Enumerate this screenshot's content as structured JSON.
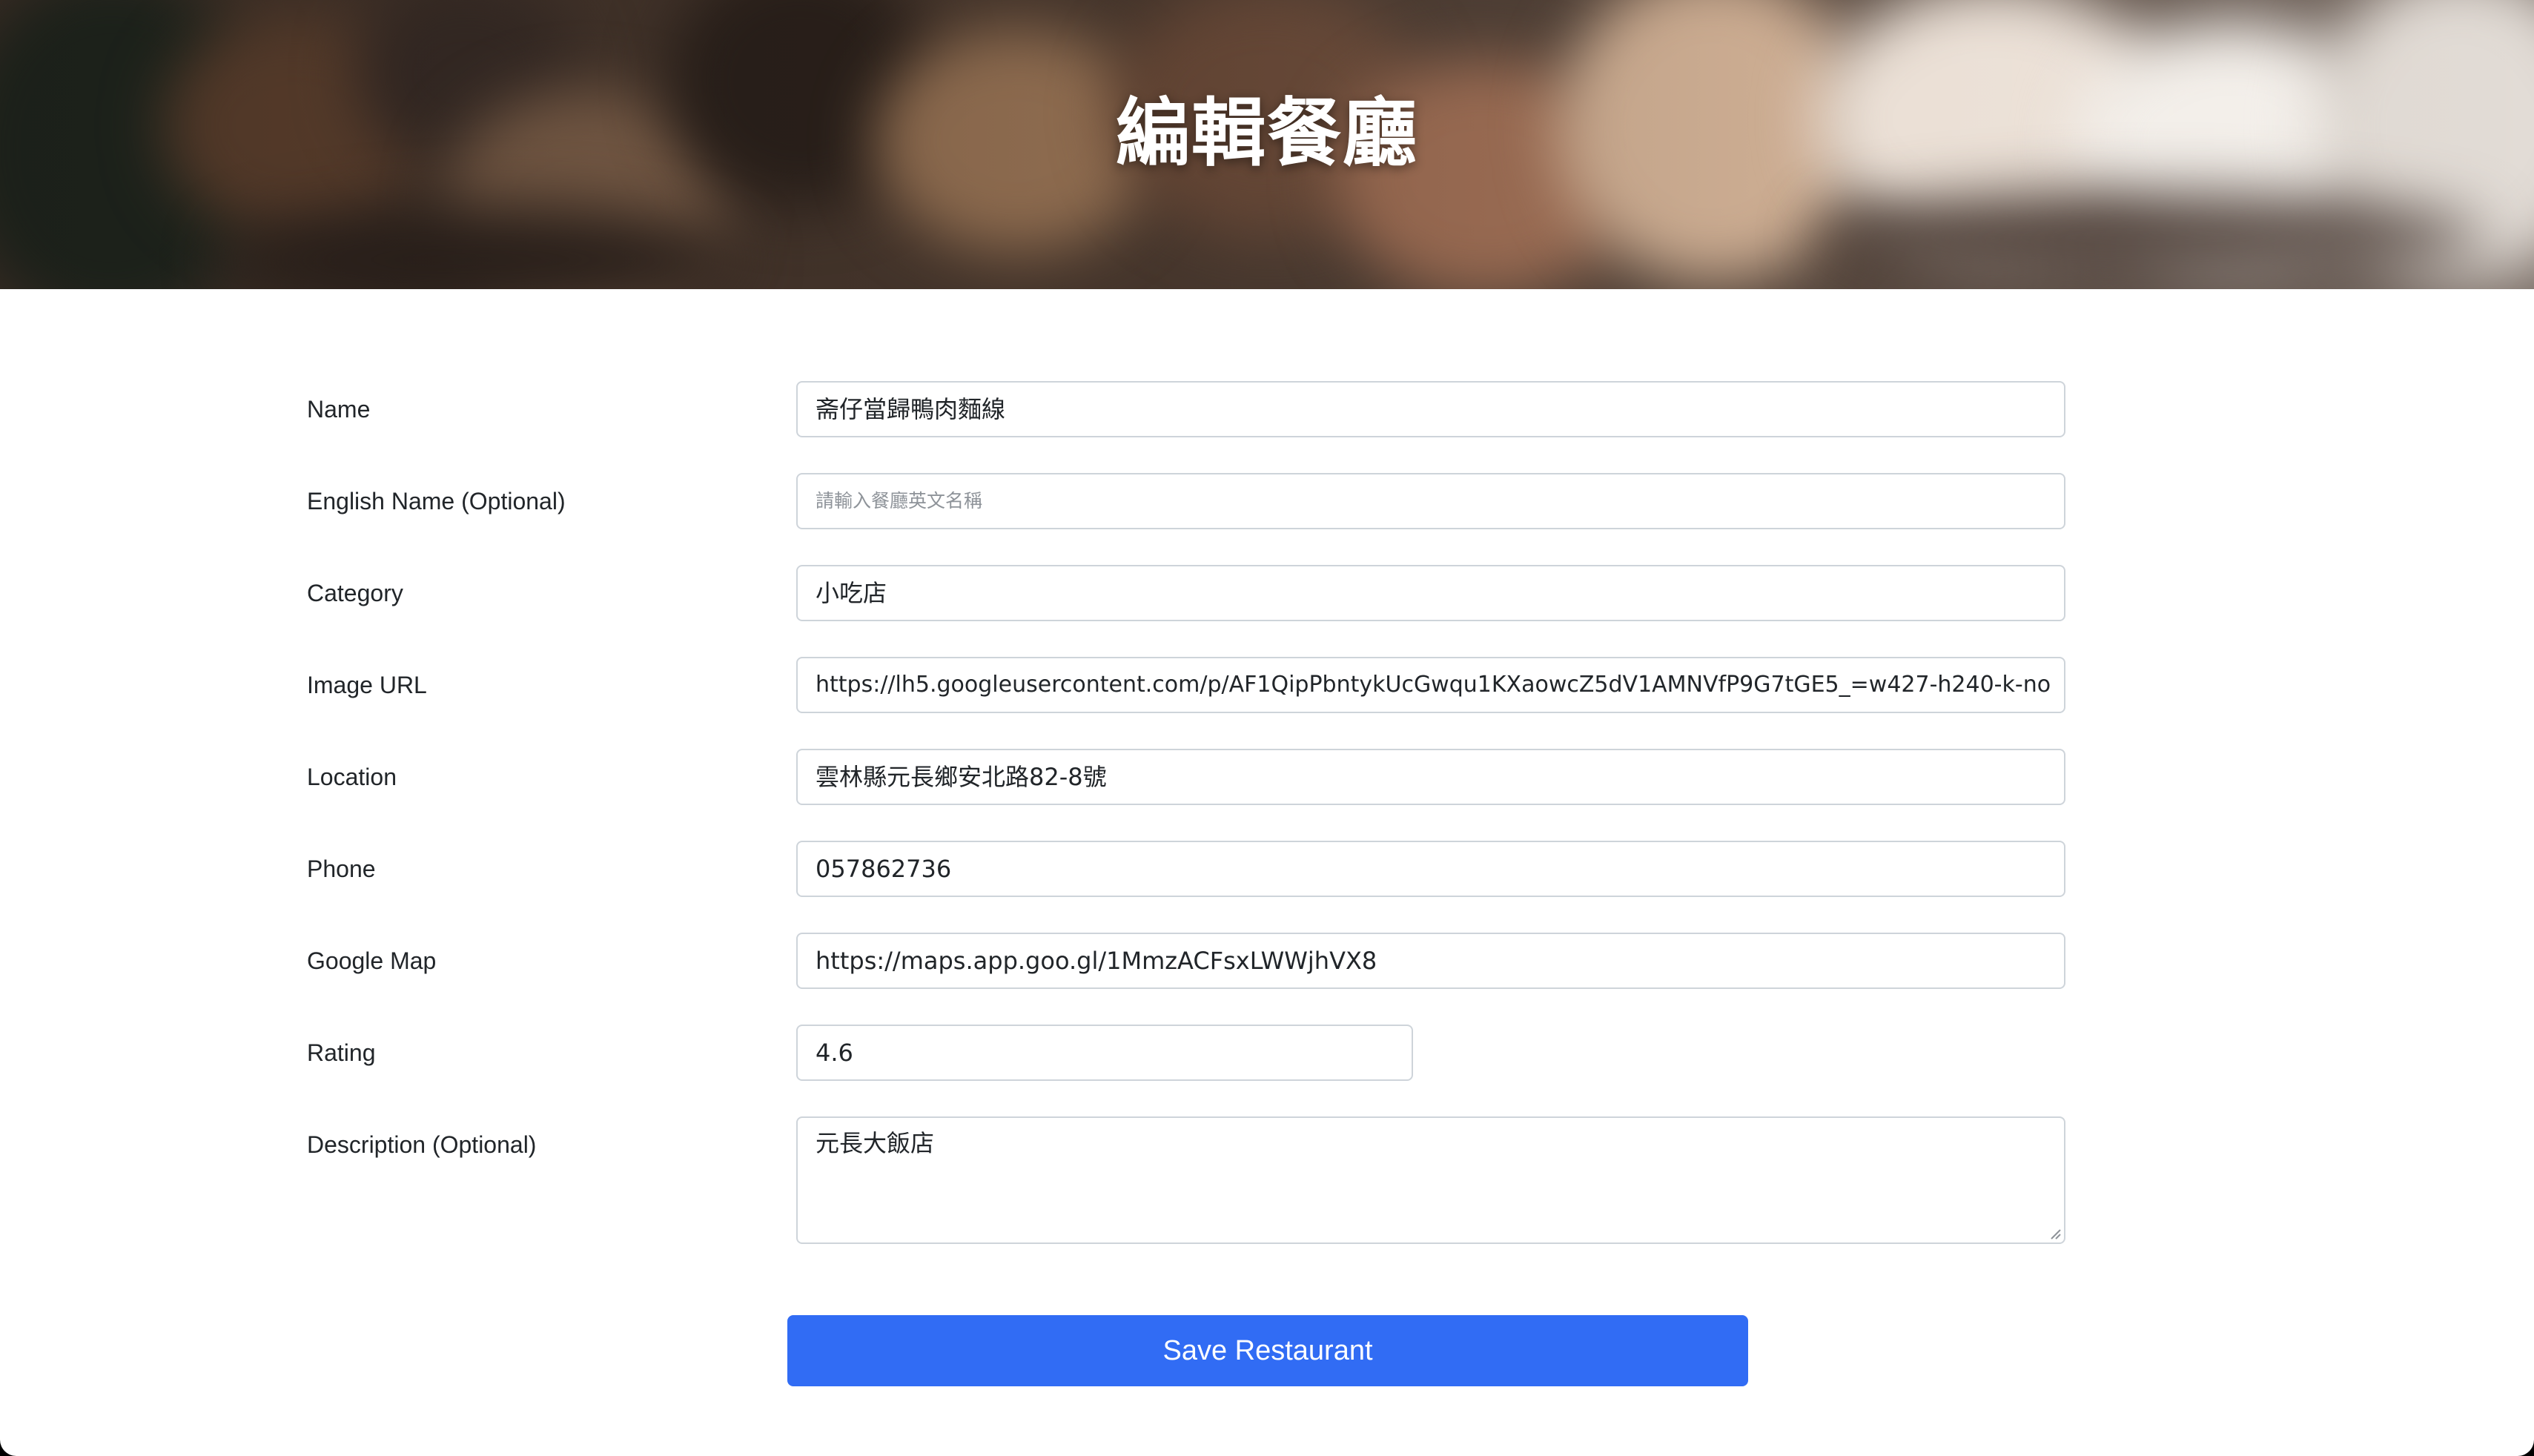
{
  "header": {
    "title": "編輯餐廳"
  },
  "form": {
    "fields": [
      {
        "label": "Name",
        "value": "斋仔當歸鴨肉麵線",
        "placeholder": ""
      },
      {
        "label": "English Name (Optional)",
        "value": "",
        "placeholder": "請輸入餐廳英文名稱"
      },
      {
        "label": "Category",
        "value": "小吃店",
        "placeholder": ""
      },
      {
        "label": "Image URL",
        "value": "https://lh5.googleusercontent.com/p/AF1QipPbntykUcGwqu1KXaowcZ5dV1AMNVfP9G7tGE5_=w427-h240-k-no",
        "placeholder": ""
      },
      {
        "label": "Location",
        "value": "雲林縣元長鄉安北路82-8號",
        "placeholder": ""
      },
      {
        "label": "Phone",
        "value": "057862736",
        "placeholder": ""
      },
      {
        "label": "Google Map",
        "value": "https://maps.app.goo.gl/1MmzACFsxLWWjhVX8",
        "placeholder": ""
      },
      {
        "label": "Rating",
        "value": "4.6",
        "placeholder": ""
      },
      {
        "label": "Description (Optional)",
        "value": "元長大飯店",
        "placeholder": ""
      }
    ],
    "submit_label": "Save Restaurant"
  },
  "colors": {
    "accent": "#316cf4",
    "border": "#ced4da",
    "text": "#212529",
    "placeholder": "#8e9399"
  }
}
